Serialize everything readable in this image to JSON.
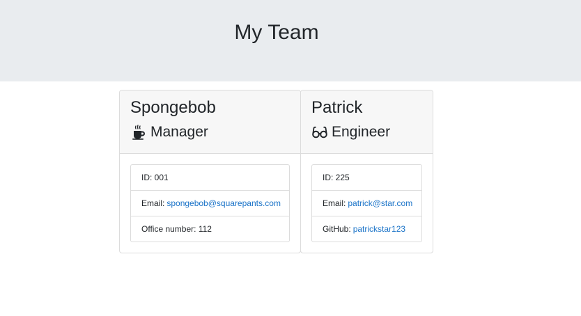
{
  "header": {
    "title": "My Team"
  },
  "team": [
    {
      "name": "Spongebob",
      "role": "Manager",
      "role_icon": "coffee-icon",
      "id_text": "ID: 001",
      "email_label": "Email:",
      "email": "spongebob@squarepants.com",
      "extra_label": "Office number: 112",
      "extra_link": ""
    },
    {
      "name": "Patrick",
      "role": "Engineer",
      "role_icon": "glasses-icon",
      "id_text": "ID: 225",
      "email_label": "Email:",
      "email": "patrick@star.com",
      "extra_label": "GitHub:",
      "extra_link": "patrickstar123"
    }
  ],
  "colors": {
    "jumbotron_bg": "#e9ecef",
    "card_header_bg": "#f7f7f7",
    "link": "#1a73c8"
  }
}
